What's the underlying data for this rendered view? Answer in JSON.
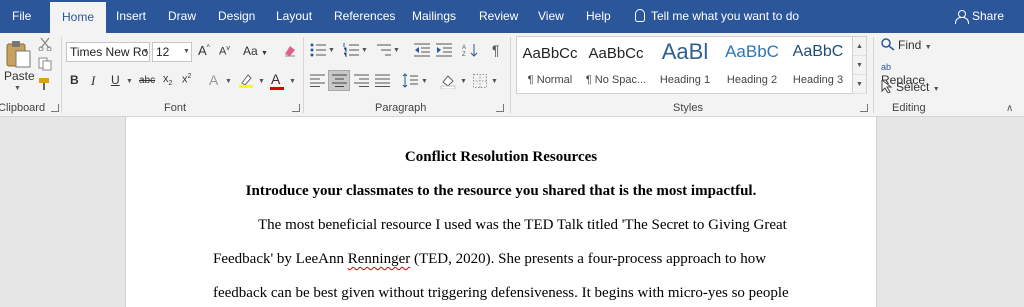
{
  "tabs": [
    "File",
    "Home",
    "Insert",
    "Draw",
    "Design",
    "Layout",
    "References",
    "Mailings",
    "Review",
    "View",
    "Help"
  ],
  "tell_me": "Tell me what you want to do",
  "share": "Share",
  "clipboard": {
    "paste": "Paste",
    "label": "Clipboard"
  },
  "font": {
    "name": "Times New Ro",
    "size": "12",
    "change_case": "Aa",
    "label": "Font"
  },
  "paragraph": {
    "label": "Paragraph"
  },
  "styles": {
    "label": "Styles",
    "items": [
      {
        "sample": "AaBbCc",
        "name": "¶ Normal"
      },
      {
        "sample": "AaBbCc",
        "name": "¶ No Spac..."
      },
      {
        "sample": "AaBl",
        "name": "Heading 1"
      },
      {
        "sample": "AaBbC",
        "name": "Heading 2"
      },
      {
        "sample": "AaBbC",
        "name": "Heading 3"
      }
    ]
  },
  "editing": {
    "find": "Find",
    "replace": "Replace",
    "select": "Select",
    "label": "Editing"
  },
  "accent_color": "#2b579a",
  "document": {
    "title": "Conflict Resolution Resources",
    "subtitle": "Introduce your classmates to the resource you shared that is the most impactful.",
    "line1": "The most beneficial resource I used was the TED Talk titled 'The Secret to Giving Great",
    "line2_before": "Feedback' by LeeAnn ",
    "line2_misspelled": "Renninger",
    "line2_after": " (TED, 2020). She presents a four-process approach to how",
    "line3": "feedback can be best given without triggering defensiveness. It begins with micro-yes so people"
  }
}
